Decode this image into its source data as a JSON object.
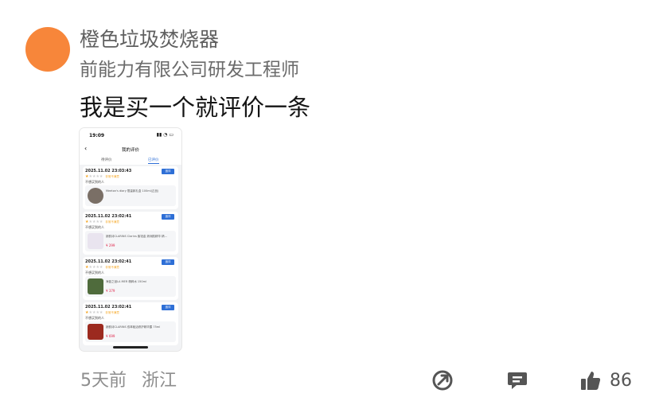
{
  "user": {
    "name": "橙色垃圾焚烧器",
    "title": "前能力有限公司研发工程师"
  },
  "comment": {
    "text": "我是买一个就评价一条"
  },
  "screenshot": {
    "status_time": "19:09",
    "nav_title": "我的评价",
    "tabs": [
      "待评价",
      "已评价"
    ],
    "reviews": [
      {
        "date": "2025.11.02 23:03:43",
        "rating_text": "非常不满意",
        "button": "追评",
        "note": "不想买到的人",
        "product": "Meeton's diary 限量款礼盒 100ml(正品)",
        "price": ""
      },
      {
        "date": "2025.11.02 23:02:41",
        "rating_text": "非常不满意",
        "button": "追评",
        "note": "不想买到的人",
        "product": "娇韵诗CLARINS Clarins 紫铂金 娇润肌精华 精…",
        "price": "¥ 299"
      },
      {
        "date": "2025.11.02 23:02:41",
        "rating_text": "非常不满意",
        "button": "追评",
        "note": "不想买到的人",
        "product": "海蓝之谜LA MER 精粹水 150ml",
        "price": "¥ 379"
      },
      {
        "date": "2025.11.02 23:02:41",
        "rating_text": "非常不满意",
        "button": "追评",
        "note": "不想买到的人",
        "product": "娇韵诗CLARINS 双萃赋活修护精华露 75ml",
        "price": "¥ 699"
      }
    ]
  },
  "meta": {
    "time": "5天前",
    "location": "浙江"
  },
  "actions": {
    "like_count": "86"
  },
  "colors": {
    "avatar": "#F7863A",
    "accent": "#2e6fd6",
    "price": "#e0274c",
    "star": "#f5a623"
  }
}
